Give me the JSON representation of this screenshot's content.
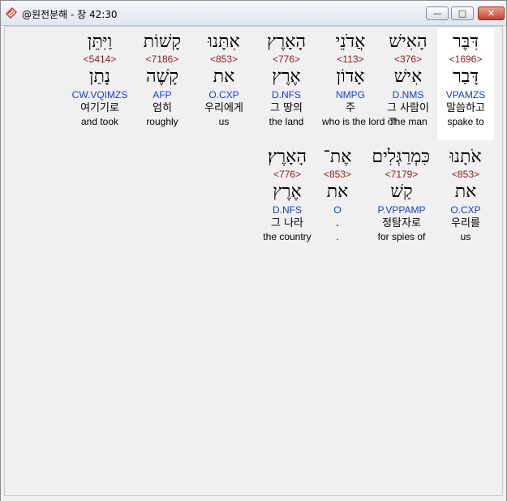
{
  "window": {
    "title": "@원전분해 - 창 42:30",
    "buttons": {
      "minimize": "—",
      "maximize": "□",
      "close": "✕"
    }
  },
  "verse": {
    "rows": [
      [
        {
          "heb": "דִּבֶּר",
          "strong": "<1696>",
          "lemma": "דָּבַר",
          "morph": "VPAMZS",
          "kor": "말씀하고",
          "eng": "spake to"
        },
        {
          "heb": "הָאִישׁ",
          "strong": "<376>",
          "lemma": "אִישׁ",
          "morph": "D.NMS",
          "kor": "그 사람이",
          "eng": "The man"
        },
        {
          "heb": "אֲדֹנֵי",
          "strong": "<113>",
          "lemma": "אָדוֹן",
          "morph": "NMPG",
          "kor": "주",
          "eng": "who is the lord of"
        },
        {
          "heb": "הָאָרֶץ",
          "strong": "<776>",
          "lemma": "אֶרֶץ",
          "morph": "D.NFS",
          "kor": "그 땅의",
          "eng": "the land"
        },
        {
          "heb": "אִתָּנוּ",
          "strong": "<853>",
          "lemma": "את",
          "morph": "O.CXP",
          "kor": "우리에게",
          "eng": "us"
        },
        {
          "heb": "קָשׁוֹת",
          "strong": "<7186>",
          "lemma": "קָשֶׁה",
          "morph": "AFP",
          "kor": "엄히",
          "eng": "roughly"
        },
        {
          "heb": "וַיִּתֵּן",
          "strong": "<5414>",
          "lemma": "נָתַן",
          "morph": "CW.VQIMZS",
          "kor": "여기기로",
          "eng": "and took"
        }
      ],
      [
        {
          "heb": "אֹתָנוּ",
          "strong": "<853>",
          "lemma": "את",
          "morph": "O.CXP",
          "kor": "우리를",
          "eng": "us"
        },
        {
          "heb": "כִּמְרַגְּלִים",
          "strong": "<7179>",
          "lemma": "קַשׁ",
          "morph": "P.VPPAMP",
          "kor": "정탐자로",
          "eng": "for spies of"
        },
        {
          "heb": "אֶת־",
          "strong": "<853>",
          "lemma": "את",
          "morph": "O",
          "kor": ".",
          "eng": "."
        },
        {
          "heb": "הָאָרֶץ׃",
          "strong": "<776>",
          "lemma": "אֶרֶץ",
          "morph": "D.NFS",
          "kor": "그 나라",
          "eng": "the country"
        }
      ]
    ]
  }
}
